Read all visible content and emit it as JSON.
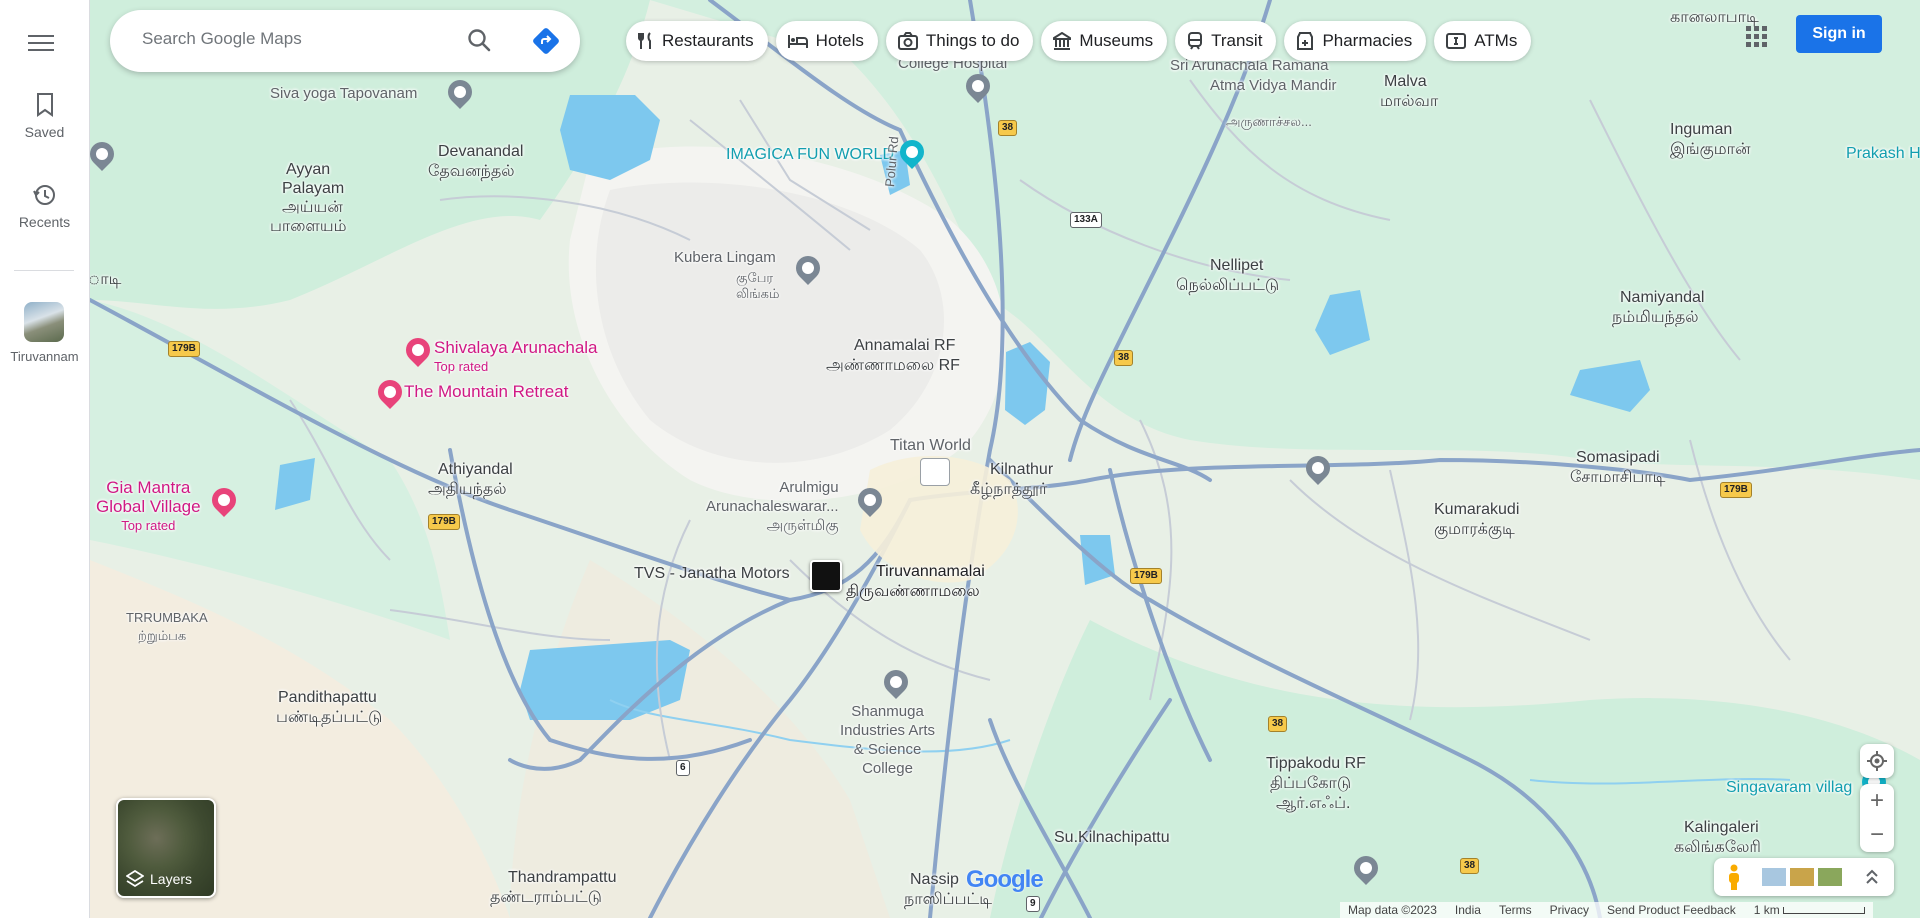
{
  "rail": {
    "saved_label": "Saved",
    "recents_label": "Recents",
    "recent_place": "Tiruvannam"
  },
  "search": {
    "placeholder": "Search Google Maps"
  },
  "chips": [
    {
      "label": "Restaurants",
      "icon": "fork-knife-icon"
    },
    {
      "label": "Hotels",
      "icon": "bed-icon"
    },
    {
      "label": "Things to do",
      "icon": "camera-icon"
    },
    {
      "label": "Museums",
      "icon": "museum-icon"
    },
    {
      "label": "Transit",
      "icon": "train-icon"
    },
    {
      "label": "Pharmacies",
      "icon": "pharmacy-icon"
    },
    {
      "label": "ATMs",
      "icon": "atm-icon"
    }
  ],
  "signin_label": "Sign in",
  "layers_label": "Layers",
  "map": {
    "places": {
      "siva_yoga": "Siva yoga Tapovanam",
      "college_hospital": "College Hospital",
      "sri_arunachala_ramana": "Sri Arunachala Ramana",
      "atma_vidya": "Atma Vidya Mandir",
      "arunachala_ta": "அருணாச்சல...",
      "malva": "Malva",
      "malva_ta": "மால்வா",
      "inguman": "Inguman",
      "inguman_ta": "இங்குமான்",
      "prakash": "Prakash H",
      "ganalapadi_ta": "கானலாபாடி",
      "devanandal": "Devanandal",
      "devanandal_ta": "தேவனந்தல்",
      "ayyan": "Ayyan",
      "palayam": "Palayam",
      "ayyan_ta": "அய்யன்",
      "palayam_ta": "பாளையம்",
      "imagica": "IMAGICA FUN WORLD",
      "polur_rd": "Polur Rd",
      "kubera": "Kubera Lingam",
      "kubera_ta1": "குபேர",
      "kubera_ta2": "லிங்கம்",
      "nellipet": "Nellipet",
      "nellipet_ta": "நெல்லிப்பட்டு",
      "namiyandal": "Namiyandal",
      "namiyandal_ta": "நம்மியந்தல்",
      "annamalai_rf": "Annamalai RF",
      "annamalai_rf_ta": "அண்ணாமலை RF",
      "shivalaya": "Shivalaya Arunachala",
      "top_rated": "Top rated",
      "mountain": "The Mountain Retreat",
      "titan": "Titan World",
      "kilnathur": "Kilnathur",
      "kilnathur_ta": "கீழ்நாத்தூர்",
      "somasipadi": "Somasipadi",
      "somasipadi_ta": "சோமாசிபாடி",
      "athiyandal": "Athiyandal",
      "athiyandal_ta": "அதியந்தல்",
      "gia1": "Gia Mantra",
      "gia2": "Global Village",
      "arulmigu": "Arulmigu",
      "arunachaleswarar": "Arunachaleswarar...",
      "arulmigu_ta": "அருள்மிகு",
      "kumarakudi": "Kumarakudi",
      "kumarakudi_ta": "குமாரக்குடி",
      "tvs": "TVS - Janatha Motors",
      "tiruvannamalai": "Tiruvannamalai",
      "tiruvannamalai_ta": "திருவண்ணாமலை",
      "trrumbaka": "TRRUMBAKA",
      "trrumbaka_ta": "ற்றும்பக",
      "adi": "ாடி",
      "pandithapattu": "Pandithapattu",
      "pandithapattu_ta": "பண்டிதப்பட்டு",
      "shanmuga1": "Shanmuga",
      "shanmuga2": "Industries Arts",
      "shanmuga3": "& Science",
      "shanmuga4": "College",
      "tippakodu": "Tippakodu RF",
      "tippakodu_ta1": "திப்பகோடு",
      "tippakodu_ta2": "ஆர்.எஃப்.",
      "singavaram": "Singavaram villag",
      "kalingaleri": "Kalingaleri",
      "kalingaleri_ta": "கலிங்கலேரி",
      "su_kilnachipattu": "Su.Kilnachipattu",
      "thandrampattu": "Thandrampattu",
      "thandrampattu_ta": "தண்டராம்பட்டு",
      "nassip": "Nassip",
      "nassip_ta": "நாஸிப்பட்டி"
    },
    "shields": {
      "r38": "38",
      "r133a": "133A",
      "r179b": "179B",
      "r6": "6",
      "r9": "9"
    }
  },
  "google_logo": "Google",
  "footer": {
    "map_data": "Map data ©2023",
    "india": "India",
    "terms": "Terms",
    "privacy": "Privacy",
    "feedback": "Send Product Feedback",
    "scale": "1 km"
  },
  "colors": {
    "accent": "#1a73e8",
    "hotel": "#d01884",
    "poi": "#5f6368",
    "water": "#7dc8ee",
    "green": "#cdeedd",
    "road": "#8aa4c8",
    "shield": "#f6c94b"
  }
}
